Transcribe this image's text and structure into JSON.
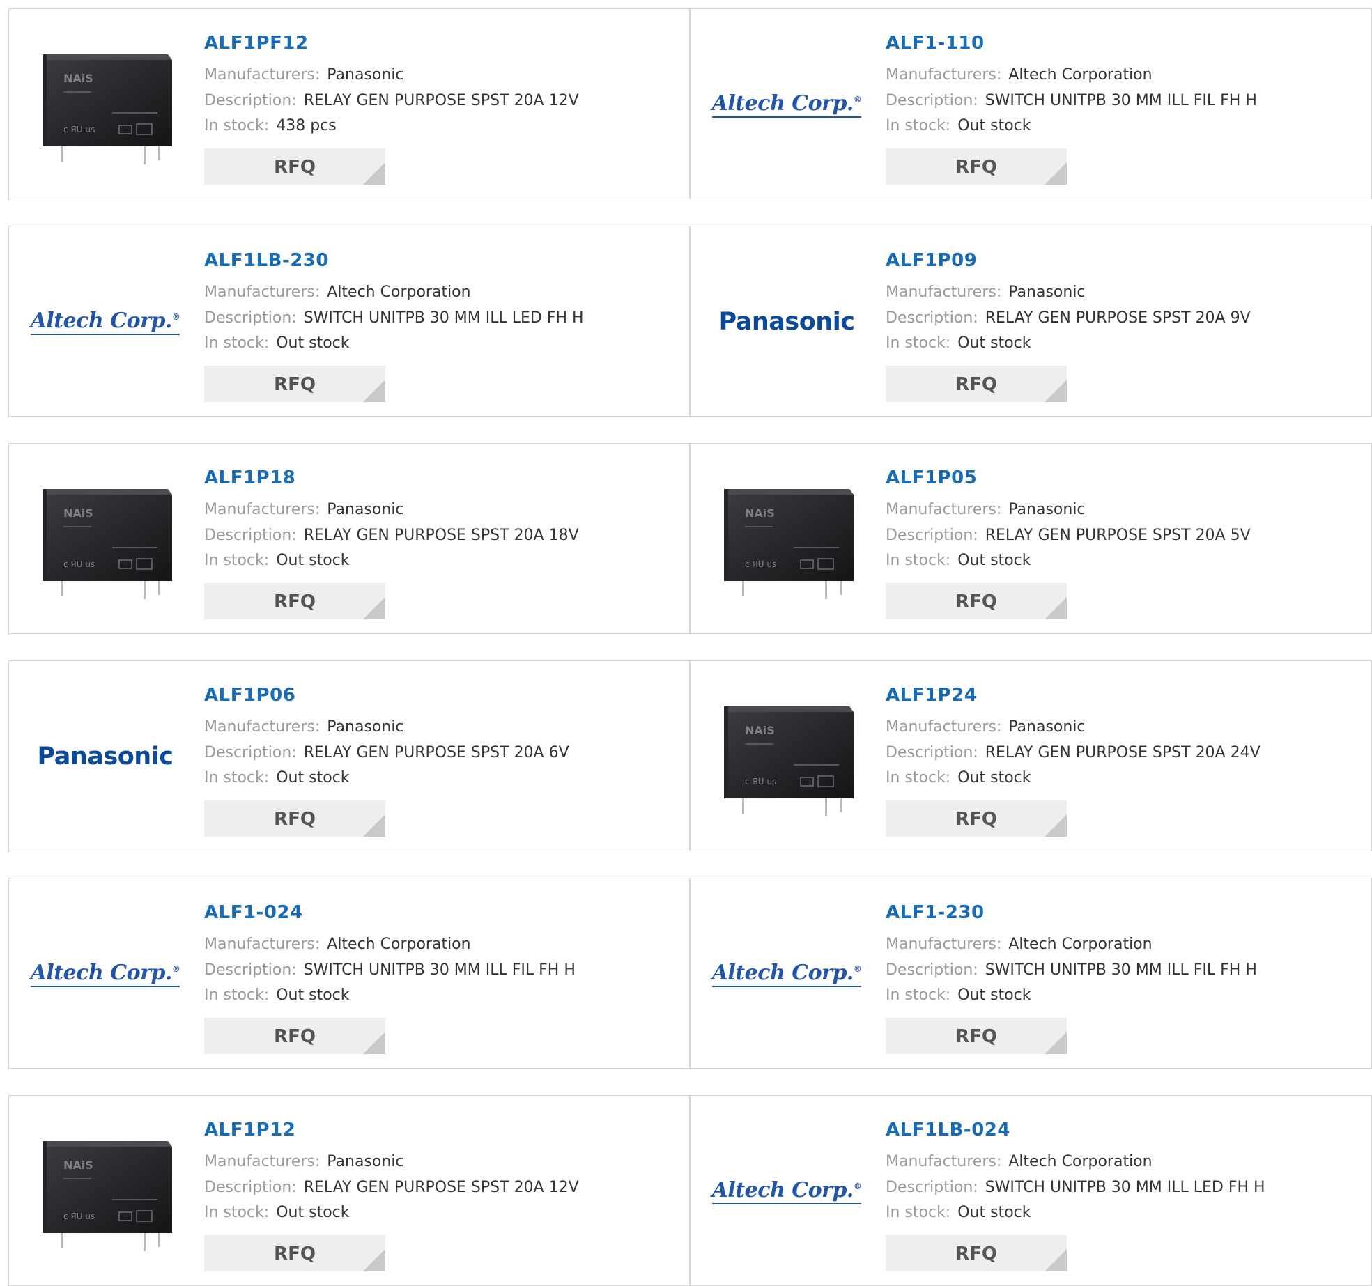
{
  "labels": {
    "manufacturer": "Manufacturers:",
    "description": "Description:",
    "stock": "In stock:",
    "rfq": "RFQ"
  },
  "colors": {
    "title": "#1a6bb5",
    "label_text": "#999999",
    "value_text": "#333333",
    "button_bg": "#eeeeee",
    "border": "#d5d5d5"
  },
  "products": [
    {
      "part": "ALF1PF12",
      "manufacturer": "Panasonic",
      "description": "RELAY GEN PURPOSE SPST 20A 12V",
      "stock": "438 pcs",
      "image": "relay-photo",
      "relay_text": {
        "brand": "NAiS",
        "cert": "c ЯU us"
      }
    },
    {
      "part": "ALF1-110",
      "manufacturer": "Altech Corporation",
      "description": "SWITCH UNITPB 30 MM ILL FIL FH H",
      "stock": "Out stock",
      "image": "altech-logo",
      "logo_text": "Altech Corp."
    },
    {
      "part": "ALF1LB-230",
      "manufacturer": "Altech Corporation",
      "description": "SWITCH UNITPB 30 MM ILL LED FH H",
      "stock": "Out stock",
      "image": "altech-logo",
      "logo_text": "Altech Corp."
    },
    {
      "part": "ALF1P09",
      "manufacturer": "Panasonic",
      "description": "RELAY GEN PURPOSE SPST 20A 9V",
      "stock": "Out stock",
      "image": "panasonic-logo",
      "logo_text": "Panasonic"
    },
    {
      "part": "ALF1P18",
      "manufacturer": "Panasonic",
      "description": "RELAY GEN PURPOSE SPST 20A 18V",
      "stock": "Out stock",
      "image": "relay-photo",
      "relay_text": {
        "brand": "NAiS",
        "cert": "c ЯU us"
      }
    },
    {
      "part": "ALF1P05",
      "manufacturer": "Panasonic",
      "description": "RELAY GEN PURPOSE SPST 20A 5V",
      "stock": "Out stock",
      "image": "relay-photo",
      "relay_text": {
        "brand": "NAiS",
        "cert": "c ЯU us"
      }
    },
    {
      "part": "ALF1P06",
      "manufacturer": "Panasonic",
      "description": "RELAY GEN PURPOSE SPST 20A 6V",
      "stock": "Out stock",
      "image": "panasonic-logo",
      "logo_text": "Panasonic"
    },
    {
      "part": "ALF1P24",
      "manufacturer": "Panasonic",
      "description": "RELAY GEN PURPOSE SPST 20A 24V",
      "stock": "Out stock",
      "image": "relay-photo",
      "relay_text": {
        "brand": "NAiS",
        "cert": "c ЯU us"
      }
    },
    {
      "part": "ALF1-024",
      "manufacturer": "Altech Corporation",
      "description": "SWITCH UNITPB 30 MM ILL FIL FH H",
      "stock": "Out stock",
      "image": "altech-logo",
      "logo_text": "Altech Corp."
    },
    {
      "part": "ALF1-230",
      "manufacturer": "Altech Corporation",
      "description": "SWITCH UNITPB 30 MM ILL FIL FH H",
      "stock": "Out stock",
      "image": "altech-logo",
      "logo_text": "Altech Corp."
    },
    {
      "part": "ALF1P12",
      "manufacturer": "Panasonic",
      "description": "RELAY GEN PURPOSE SPST 20A 12V",
      "stock": "Out stock",
      "image": "relay-photo",
      "relay_text": {
        "brand": "NAiS",
        "cert": "c ЯU us"
      }
    },
    {
      "part": "ALF1LB-024",
      "manufacturer": "Altech Corporation",
      "description": "SWITCH UNITPB 30 MM ILL LED FH H",
      "stock": "Out stock",
      "image": "altech-logo",
      "logo_text": "Altech Corp."
    }
  ]
}
